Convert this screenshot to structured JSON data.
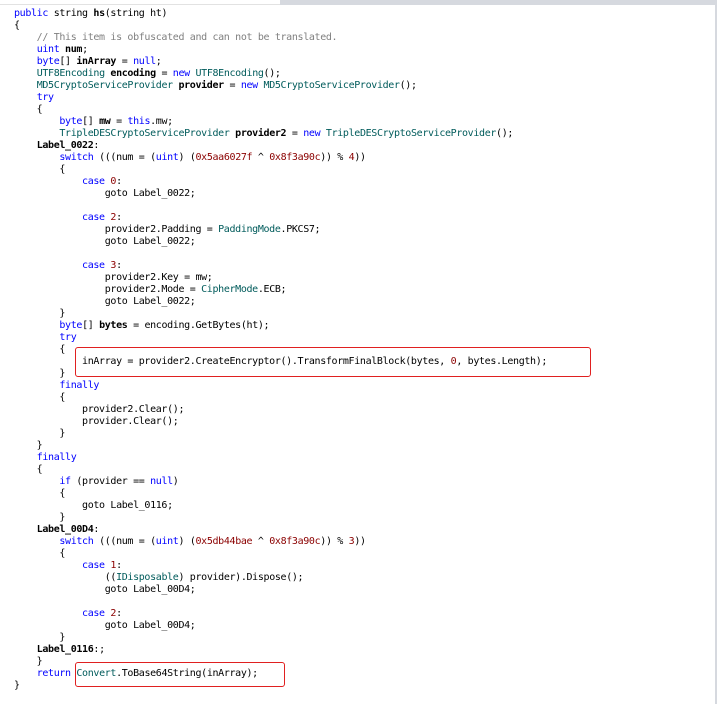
{
  "window": {
    "colors": {
      "keyword": "#0000ff",
      "type": "#005b5b",
      "comment": "#808080",
      "number": "#8b0000",
      "highlight_box": "#e02020"
    }
  },
  "lines": [
    [
      {
        "t": "public",
        "c": "kw"
      },
      {
        "t": " string "
      },
      {
        "t": "hs",
        "c": "b"
      },
      {
        "t": "(string ht)"
      }
    ],
    [
      {
        "t": "{"
      }
    ],
    [
      {
        "t": "    // This item is obfuscated and can not be translated.",
        "c": "cm"
      }
    ],
    [
      {
        "t": "    "
      },
      {
        "t": "uint",
        "c": "kw"
      },
      {
        "t": " "
      },
      {
        "t": "num",
        "c": "b"
      },
      {
        "t": ";"
      }
    ],
    [
      {
        "t": "    "
      },
      {
        "t": "byte",
        "c": "kw"
      },
      {
        "t": "[] "
      },
      {
        "t": "inArray",
        "c": "b"
      },
      {
        "t": " = "
      },
      {
        "t": "null",
        "c": "kw"
      },
      {
        "t": ";"
      }
    ],
    [
      {
        "t": "    "
      },
      {
        "t": "UTF8Encoding",
        "c": "ty"
      },
      {
        "t": " "
      },
      {
        "t": "encoding",
        "c": "b"
      },
      {
        "t": " = "
      },
      {
        "t": "new",
        "c": "kw"
      },
      {
        "t": " "
      },
      {
        "t": "UTF8Encoding",
        "c": "ty"
      },
      {
        "t": "();"
      }
    ],
    [
      {
        "t": "    "
      },
      {
        "t": "MD5CryptoServiceProvider",
        "c": "ty"
      },
      {
        "t": " "
      },
      {
        "t": "provider",
        "c": "b"
      },
      {
        "t": " = "
      },
      {
        "t": "new",
        "c": "kw"
      },
      {
        "t": " "
      },
      {
        "t": "MD5CryptoServiceProvider",
        "c": "ty"
      },
      {
        "t": "();"
      }
    ],
    [
      {
        "t": "    "
      },
      {
        "t": "try",
        "c": "kw"
      }
    ],
    [
      {
        "t": "    {"
      }
    ],
    [
      {
        "t": "        "
      },
      {
        "t": "byte",
        "c": "kw"
      },
      {
        "t": "[] "
      },
      {
        "t": "mw",
        "c": "b"
      },
      {
        "t": " = "
      },
      {
        "t": "this",
        "c": "kw"
      },
      {
        "t": ".mw;"
      }
    ],
    [
      {
        "t": "        "
      },
      {
        "t": "TripleDESCryptoServiceProvider",
        "c": "ty"
      },
      {
        "t": " "
      },
      {
        "t": "provider2",
        "c": "b"
      },
      {
        "t": " = "
      },
      {
        "t": "new",
        "c": "kw"
      },
      {
        "t": " "
      },
      {
        "t": "TripleDESCryptoServiceProvider",
        "c": "ty"
      },
      {
        "t": "();"
      }
    ],
    [
      {
        "t": "    "
      },
      {
        "t": "Label_0022",
        "c": "b"
      },
      {
        "t": ":"
      }
    ],
    [
      {
        "t": "        "
      },
      {
        "t": "switch",
        "c": "kw"
      },
      {
        "t": " (((num = ("
      },
      {
        "t": "uint",
        "c": "kw"
      },
      {
        "t": ") ("
      },
      {
        "t": "0x5aa6027f",
        "c": "nm"
      },
      {
        "t": " ^ "
      },
      {
        "t": "0x8f3a90c",
        "c": "nm"
      },
      {
        "t": ")) % "
      },
      {
        "t": "4",
        "c": "nm"
      },
      {
        "t": "))"
      }
    ],
    [
      {
        "t": "        {"
      }
    ],
    [
      {
        "t": "            "
      },
      {
        "t": "case",
        "c": "kw"
      },
      {
        "t": " "
      },
      {
        "t": "0",
        "c": "nm"
      },
      {
        "t": ":"
      }
    ],
    [
      {
        "t": "                goto Label_0022;"
      }
    ],
    [
      {
        "t": ""
      }
    ],
    [
      {
        "t": "            "
      },
      {
        "t": "case",
        "c": "kw"
      },
      {
        "t": " "
      },
      {
        "t": "2",
        "c": "nm"
      },
      {
        "t": ":"
      }
    ],
    [
      {
        "t": "                provider2.Padding = "
      },
      {
        "t": "PaddingMode",
        "c": "ty"
      },
      {
        "t": ".PKCS7;"
      }
    ],
    [
      {
        "t": "                goto Label_0022;"
      }
    ],
    [
      {
        "t": ""
      }
    ],
    [
      {
        "t": "            "
      },
      {
        "t": "case",
        "c": "kw"
      },
      {
        "t": " "
      },
      {
        "t": "3",
        "c": "nm"
      },
      {
        "t": ":"
      }
    ],
    [
      {
        "t": "                provider2.Key = mw;"
      }
    ],
    [
      {
        "t": "                provider2.Mode = "
      },
      {
        "t": "CipherMode",
        "c": "ty"
      },
      {
        "t": ".ECB;"
      }
    ],
    [
      {
        "t": "                goto Label_0022;"
      }
    ],
    [
      {
        "t": "        }"
      }
    ],
    [
      {
        "t": "        "
      },
      {
        "t": "byte",
        "c": "kw"
      },
      {
        "t": "[] "
      },
      {
        "t": "bytes",
        "c": "b"
      },
      {
        "t": " = encoding.GetBytes(ht);"
      }
    ],
    [
      {
        "t": "        "
      },
      {
        "t": "try",
        "c": "kw"
      }
    ],
    [
      {
        "t": "        {"
      }
    ],
    [
      {
        "t": "            inArray = provider2.CreateEncryptor().TransformFinalBlock(bytes, "
      },
      {
        "t": "0",
        "c": "nm"
      },
      {
        "t": ", bytes.Length);"
      }
    ],
    [
      {
        "t": "        }"
      }
    ],
    [
      {
        "t": "        "
      },
      {
        "t": "finally",
        "c": "kw"
      }
    ],
    [
      {
        "t": "        {"
      }
    ],
    [
      {
        "t": "            provider2.Clear();"
      }
    ],
    [
      {
        "t": "            provider.Clear();"
      }
    ],
    [
      {
        "t": "        }"
      }
    ],
    [
      {
        "t": "    }"
      }
    ],
    [
      {
        "t": "    "
      },
      {
        "t": "finally",
        "c": "kw"
      }
    ],
    [
      {
        "t": "    {"
      }
    ],
    [
      {
        "t": "        "
      },
      {
        "t": "if",
        "c": "kw"
      },
      {
        "t": " (provider == "
      },
      {
        "t": "null",
        "c": "kw"
      },
      {
        "t": ")"
      }
    ],
    [
      {
        "t": "        {"
      }
    ],
    [
      {
        "t": "            goto Label_0116;"
      }
    ],
    [
      {
        "t": "        }"
      }
    ],
    [
      {
        "t": "    "
      },
      {
        "t": "Label_00D4",
        "c": "b"
      },
      {
        "t": ":"
      }
    ],
    [
      {
        "t": "        "
      },
      {
        "t": "switch",
        "c": "kw"
      },
      {
        "t": " (((num = ("
      },
      {
        "t": "uint",
        "c": "kw"
      },
      {
        "t": ") ("
      },
      {
        "t": "0x5db44bae",
        "c": "nm"
      },
      {
        "t": " ^ "
      },
      {
        "t": "0x8f3a90c",
        "c": "nm"
      },
      {
        "t": ")) % "
      },
      {
        "t": "3",
        "c": "nm"
      },
      {
        "t": "))"
      }
    ],
    [
      {
        "t": "        {"
      }
    ],
    [
      {
        "t": "            "
      },
      {
        "t": "case",
        "c": "kw"
      },
      {
        "t": " "
      },
      {
        "t": "1",
        "c": "nm"
      },
      {
        "t": ":"
      }
    ],
    [
      {
        "t": "                (("
      },
      {
        "t": "IDisposable",
        "c": "ty"
      },
      {
        "t": ") provider).Dispose();"
      }
    ],
    [
      {
        "t": "                goto Label_00D4;"
      }
    ],
    [
      {
        "t": ""
      }
    ],
    [
      {
        "t": "            "
      },
      {
        "t": "case",
        "c": "kw"
      },
      {
        "t": " "
      },
      {
        "t": "2",
        "c": "nm"
      },
      {
        "t": ":"
      }
    ],
    [
      {
        "t": "                goto Label_00D4;"
      }
    ],
    [
      {
        "t": "        }"
      }
    ],
    [
      {
        "t": "    "
      },
      {
        "t": "Label_0116",
        "c": "b"
      },
      {
        "t": ":;"
      }
    ],
    [
      {
        "t": "    }"
      }
    ],
    [
      {
        "t": "    "
      },
      {
        "t": "return",
        "c": "kw"
      },
      {
        "t": " "
      },
      {
        "t": "Convert",
        "c": "ty"
      },
      {
        "t": ".ToBase64String(inArray);"
      }
    ],
    [
      {
        "t": "}"
      }
    ]
  ]
}
